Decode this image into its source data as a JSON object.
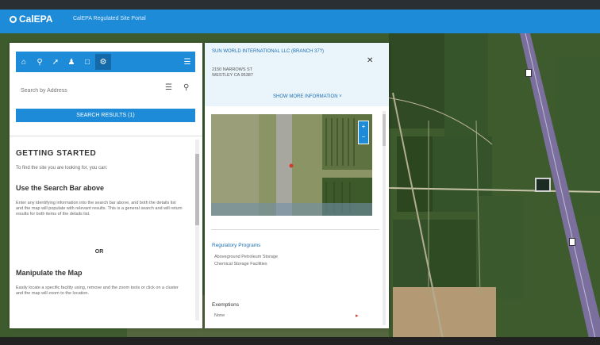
{
  "header": {
    "logo_text": "CalEPA",
    "app_title": "CalEPA Regulated Site Portal"
  },
  "colors": {
    "accent": "#1e8bd8",
    "header_dark": "#2a2f34",
    "link": "#1e6fb0"
  },
  "toolbar": {
    "icons": [
      "home-icon",
      "map-pin-icon",
      "ruler-icon",
      "user-icon",
      "book-icon",
      "gear-icon",
      "list-icon"
    ],
    "active_index": 5
  },
  "search": {
    "placeholder": "Search by Address"
  },
  "results_button": {
    "label": "SEARCH RESULTS (1)"
  },
  "getting_started": {
    "title": "GETTING STARTED",
    "intro": "To find the site you are looking for, you can:",
    "search_heading": "Use the Search Bar above",
    "search_text": "Enter any identifying information into the search bar above, and both the details list and the map will populate with relevant results. This is a general search and will return results for both items of the details list.",
    "or_label": "OR",
    "map_heading": "Manipulate the Map",
    "map_text": "Easily locate a specific facility using, remove and the zoom tools or click on a cluster and the map will zoom to the location."
  },
  "popup": {
    "site_name": "SUN WORLD INTERNATIONAL LLC (BRANCH 37?)",
    "address_line1": "2150 NARROWS ST",
    "address_line2": "WESTLEY CA 95387",
    "more_info_label": "SHOW MORE INFORMATION",
    "programs_title": "Regulatory Programs",
    "program_1": "Aboveground Petroleum Storage",
    "program_2": "Chemical Storage Facilities",
    "exemptions_title": "Exemptions",
    "exemptions_value": "None"
  }
}
